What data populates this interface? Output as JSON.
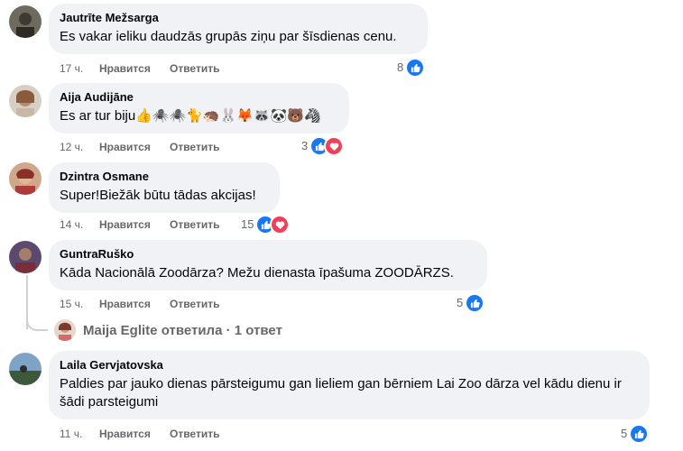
{
  "comments": [
    {
      "author": "Jautrīte Mežsarga",
      "text": "Es vakar ieliku daudzās grupās ziņu par šīsdienas cenu.",
      "time": "17 ч.",
      "like_label": "Нравится",
      "reply_label": "Ответить",
      "reaction_count": "8",
      "reactions": [
        "like-icon"
      ]
    },
    {
      "author": "Aija Audijāne",
      "text": "Es ar tur biju👍🕷️🕷️🐈🦔🐰🦊🦝🐼🐻🦓",
      "time": "12 ч.",
      "like_label": "Нравится",
      "reply_label": "Ответить",
      "reaction_count": "3",
      "reactions": [
        "like-icon",
        "love-icon"
      ]
    },
    {
      "author": "Dzintra Osmane",
      "text": "Super!Biežāk būtu tādas akcijas!",
      "time": "14 ч.",
      "like_label": "Нравится",
      "reply_label": "Ответить",
      "reaction_count": "15",
      "reactions": [
        "like-icon",
        "love-icon"
      ]
    },
    {
      "author": "GuntraRuško",
      "text": "Kāda Nacionālā Zoodārza? Mežu dienasta īpašuma ZOODĀRZS.",
      "time": "15 ч.",
      "like_label": "Нравится",
      "reply_label": "Ответить",
      "reaction_count": "5",
      "reactions": [
        "like-icon"
      ]
    },
    {
      "author": "Laila Gervjatovska",
      "text": "Paldies par jauko dienas pārsteigumu gan lieliem gan bērniem Lai Zoo dārza vel kādu dienu ir šādi parsteigumi",
      "time": "11 ч.",
      "like_label": "Нравится",
      "reply_label": "Ответить",
      "reaction_count": "5",
      "reactions": [
        "like-icon"
      ]
    }
  ],
  "reply_thread": {
    "text": "Maija Eglite ответила · 1 ответ"
  },
  "colors": {
    "bubble": "#f0f2f5",
    "like": "#1877f2",
    "love": "#f33e58",
    "meta": "#65676b"
  }
}
